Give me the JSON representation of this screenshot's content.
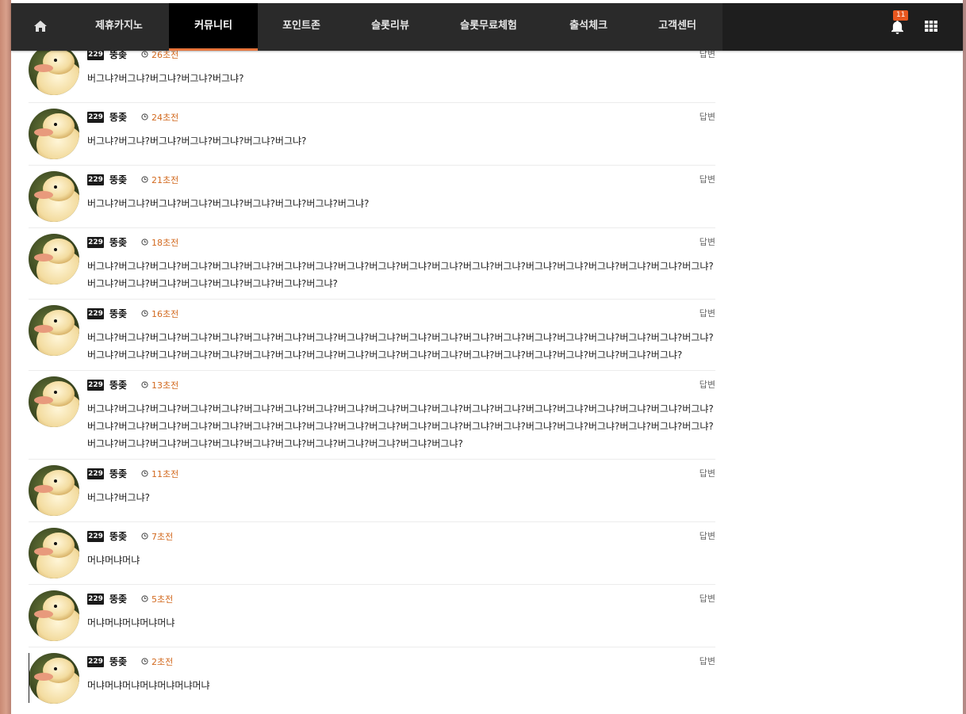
{
  "nav": {
    "items": [
      "제휴카지노",
      "커뮤니티",
      "포인트존",
      "슬롯리뷰",
      "슬롯무료체험",
      "출석체크",
      "고객센터"
    ],
    "active_index": 1,
    "notification_count": "11"
  },
  "colors": {
    "accent": "#e8743b",
    "time": "#d2691e",
    "nav_bg": "#2a2a2a",
    "badge": "#e8571f"
  },
  "comments": [
    {
      "level": "229",
      "nick": "뚱좆",
      "time": "26초전",
      "reply": "답변",
      "text": "버그냐?버그냐?버그냐?버그냐?버그냐?"
    },
    {
      "level": "229",
      "nick": "뚱좆",
      "time": "24초전",
      "reply": "답변",
      "text": "버그냐?버그냐?버그냐?버그냐?버그냐?버그냐?버그냐?"
    },
    {
      "level": "229",
      "nick": "뚱좆",
      "time": "21초전",
      "reply": "답변",
      "text": "버그냐?버그냐?버그냐?버그냐?버그냐?버그냐?버그냐?버그냐?버그냐?"
    },
    {
      "level": "229",
      "nick": "뚱좆",
      "time": "18초전",
      "reply": "답변",
      "text": "버그냐?버그냐?버그냐?버그냐?버그냐?버그냐?버그냐?버그냐?버그냐?버그냐?버그냐?버그냐?버그냐?버그냐?버그냐?버그냐?버그냐?버그냐?버그냐?버그냐?버그냐?버그냐?버그냐?버그냐?버그냐?버그냐?버그냐?버그냐?"
    },
    {
      "level": "229",
      "nick": "뚱좆",
      "time": "16초전",
      "reply": "답변",
      "text": "버그냐?버그냐?버그냐?버그냐?버그냐?버그냐?버그냐?버그냐?버그냐?버그냐?버그냐?버그냐?버그냐?버그냐?버그냐?버그냐?버그냐?버그냐?버그냐?버그냐?버그냐?버그냐?버그냐?버그냐?버그냐?버그냐?버그냐?버그냐?버그냐?버그냐?버그냐?버그냐?버그냐?버그냐?버그냐?버그냐?버그냐?버그냐?버그냐?"
    },
    {
      "level": "229",
      "nick": "뚱좆",
      "time": "13초전",
      "reply": "답변",
      "text": "버그냐?버그냐?버그냐?버그냐?버그냐?버그냐?버그냐?버그냐?버그냐?버그냐?버그냐?버그냐?버그냐?버그냐?버그냐?버그냐?버그냐?버그냐?버그냐?버그냐?버그냐?버그냐?버그냐?버그냐?버그냐?버그냐?버그냐?버그냐?버그냐?버그냐?버그냐?버그냐?버그냐?버그냐?버그냐?버그냐?버그냐?버그냐?버그냐?버그냐?버그냐?버그냐?버그냐?버그냐?버그냐?버그냐?버그냐?버그냐?버그냐?버그냐?버그냐?버그냐?"
    },
    {
      "level": "229",
      "nick": "뚱좆",
      "time": "11초전",
      "reply": "답변",
      "text": "버그냐?버그냐?"
    },
    {
      "level": "229",
      "nick": "뚱좆",
      "time": "7초전",
      "reply": "답변",
      "text": "머냐머냐머냐"
    },
    {
      "level": "229",
      "nick": "뚱좆",
      "time": "5초전",
      "reply": "답변",
      "text": "머냐머냐머냐머냐머냐"
    },
    {
      "level": "229",
      "nick": "뚱좆",
      "time": "2초전",
      "reply": "답변",
      "text": "머냐머냐머냐머냐머냐머냐머냐"
    }
  ]
}
